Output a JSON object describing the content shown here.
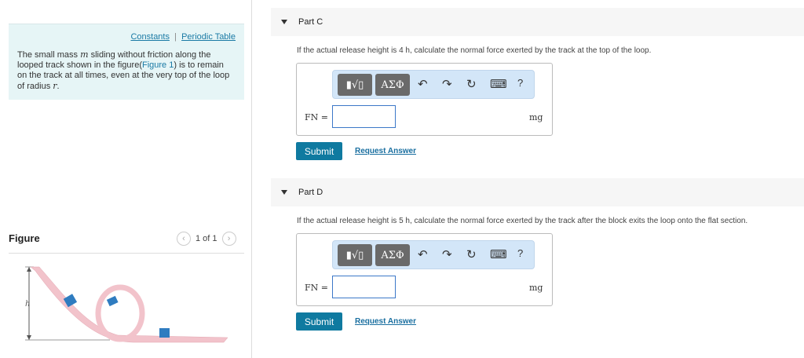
{
  "info": {
    "constants": "Constants",
    "separator": "|",
    "periodic": "Periodic Table",
    "text1": "The small mass ",
    "var_m": "m",
    "text2": " sliding without friction along the looped track shown in the figure(",
    "figure_link": "Figure 1",
    "text3": ") is to remain on the track at all times, even at the very top of the loop of radius ",
    "var_r": "r",
    "text4": "."
  },
  "figure": {
    "title": "Figure",
    "pager": "1 of 1",
    "prev": "‹",
    "next": "›",
    "h_label": "h"
  },
  "parts": [
    {
      "title": "Part C",
      "question": "If the actual release height is 4 h, calculate the normal force exerted by the track at the top of the loop.",
      "label": "FN =",
      "unit": "mg",
      "submit": "Submit",
      "request": "Request Answer"
    },
    {
      "title": "Part D",
      "question": "If the actual release height is 5 h, calculate the normal force exerted by the track after the block exits the loop onto the flat section.",
      "label": "FN =",
      "unit": "mg",
      "submit": "Submit",
      "request": "Request Answer"
    }
  ],
  "toolbar": {
    "template": "▮√▯",
    "greek": "ΑΣΦ",
    "undo": "↶",
    "redo": "↷",
    "reset": "↻",
    "keyboard": "⌨",
    "help": "?"
  },
  "colors": {
    "accent": "#0f7aa0",
    "info_bg": "#e6f5f6",
    "toolbar_bg": "#d3e6f8"
  }
}
